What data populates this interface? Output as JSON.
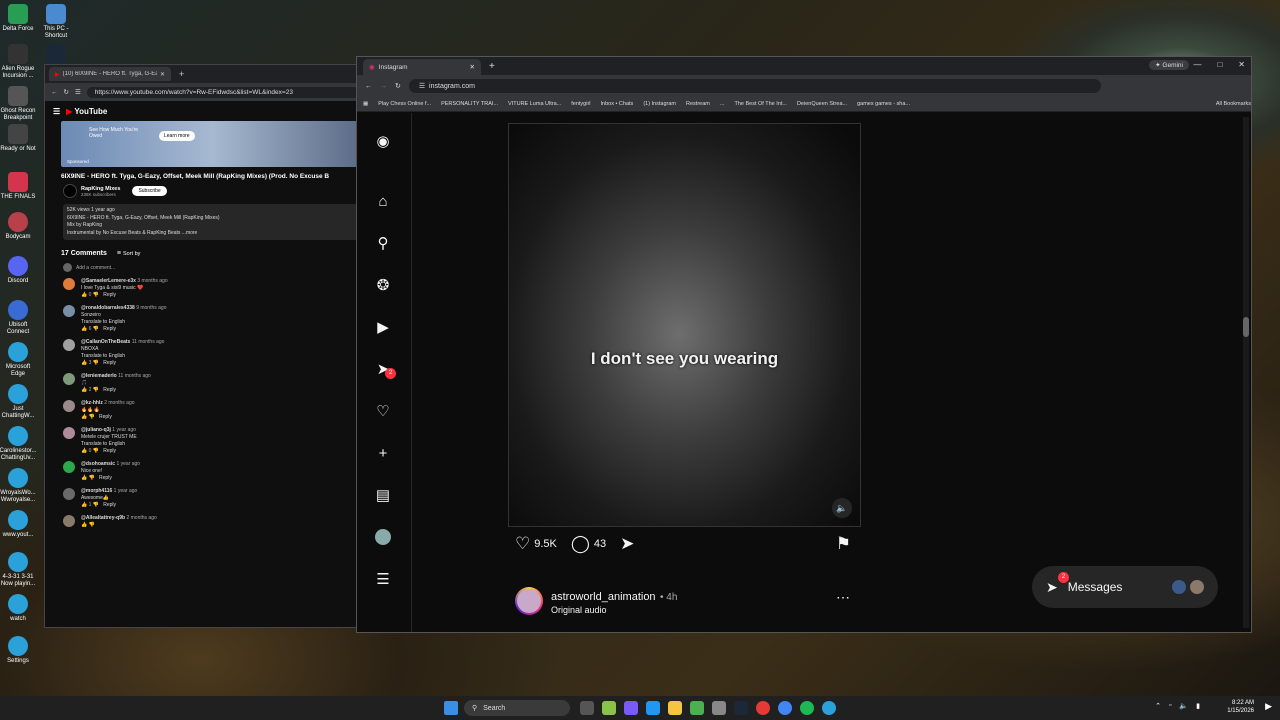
{
  "desktop": {
    "icons": [
      "Delta Force",
      "This PC - Shortcut",
      "Alien Rogue Incursion ...",
      "",
      "Ghost Recon Breakpoint",
      "Ready or Not",
      "THE FINALS",
      "Bodycam",
      "Discord",
      "Ubisoft Connect",
      "Microsoft Edge",
      "Just ChattingW...",
      "Carolinestor... ChattingUv...",
      "WroyalsWo... Wwroyalse...",
      "www.yout...",
      "4-3-31 3-31 Now playin...",
      "watch",
      "Settings"
    ]
  },
  "youtube_window": {
    "tab_title": "(10) 6IX9INE - HERO ft. Tyga, G-Ea...",
    "url": "https://www.youtube.com/watch?v=Rw-EFidwdsc&list=WL&index=23",
    "logo": "YouTube",
    "ad": {
      "text": "See How Much You're Owed",
      "cta": "Learn more",
      "sponsored": "Sponsored"
    },
    "video_title": "6IX9INE - HERO ft. Tyga, G-Eazy, Offset, Meek Mill (RapKing Mixes) (Prod. No Excuse B",
    "channel": {
      "name": "RapKing Mixes",
      "subs": "238K subscribers",
      "subscribe": "Subscribe"
    },
    "description": [
      "52K views  1 year ago",
      "6IX9INE - HERO ft. Tyga, G-Eazy, Offset, Meek Mill (RapKing Mixes)",
      "Mix by RapKing",
      "Instrumental by No Excuse Beats & RapKing Beats  ...more"
    ],
    "comments_header": "17 Comments",
    "sort_by": "Sort by",
    "add_comment": "Add a comment...",
    "comments": [
      {
        "user": "@SamaelerLemere-e3x",
        "time": "3 months ago",
        "text": "I love Tyga & sixi9 music ❤️",
        "likes": "0",
        "reply": "Reply",
        "color": "#e07b39"
      },
      {
        "user": "@ronaldobarrales4338",
        "time": "9 months ago",
        "text": "Sonzeiro",
        "extra": "Translate to English",
        "likes": "6",
        "reply": "Reply",
        "color": "#7a8fa6"
      },
      {
        "user": "@CallanOnTheBeats",
        "time": "11 months ago",
        "text": "NBOXA",
        "extra": "Translate to English",
        "likes": "3",
        "reply": "Reply",
        "color": "#a0a0a0"
      },
      {
        "user": "@leniemaderlo",
        "time": "11 months ago",
        "text": "🎵",
        "likes": "2",
        "reply": "Reply",
        "color": "#7d9a7a"
      },
      {
        "user": "@kz-hhlz",
        "time": "2 months ago",
        "text": "🔥🔥🔥",
        "likes": "",
        "reply": "Reply",
        "color": "#9a8a8a"
      },
      {
        "user": "@juliano-q3j",
        "time": "1 year ago",
        "text": "Metele crujer TRUST ME",
        "extra": "Translate to English",
        "likes": "0",
        "reply": "Reply",
        "color": "#b08a9a"
      },
      {
        "user": "@dsohoamsic",
        "time": "1 year ago",
        "text": "Nice one!",
        "likes": "",
        "reply": "Reply",
        "color": "#2aa84a"
      },
      {
        "user": "@morph4116",
        "time": "1 year ago",
        "text": "Awesome👍",
        "likes": "1",
        "reply": "Reply",
        "color": "#6a6a6a"
      },
      {
        "user": "@Allealtattrey-q9b",
        "time": "2 months ago",
        "text": "",
        "likes": "",
        "reply": "",
        "color": "#8a7a6a"
      }
    ]
  },
  "instagram_window": {
    "tab_title": "Instagram",
    "gemini": "Gemini",
    "url": "instagram.com",
    "bookmarks": [
      "Play Chess Online f...",
      "PERSONALITY TRAI...",
      "VITURE Luma Ultra...",
      "fentygirl",
      "Inbox • Chats",
      "(1) Instagram",
      "Restream",
      "...",
      "The Best Of The Int...",
      "DeienQueen Strea...",
      "games games - sha...",
      "All Bookmarks"
    ],
    "notif_count": "2",
    "video_caption": "I don't see you wearing",
    "likes": "9.5K",
    "comments": "43",
    "next_post": {
      "user": "astroworld_animation",
      "time": "• 4h",
      "audio": "Original audio"
    },
    "messages": {
      "label": "Messages",
      "count": "2"
    }
  },
  "taskbar": {
    "search": "Search",
    "time": "8:22 AM",
    "date": "1/15/2026"
  }
}
